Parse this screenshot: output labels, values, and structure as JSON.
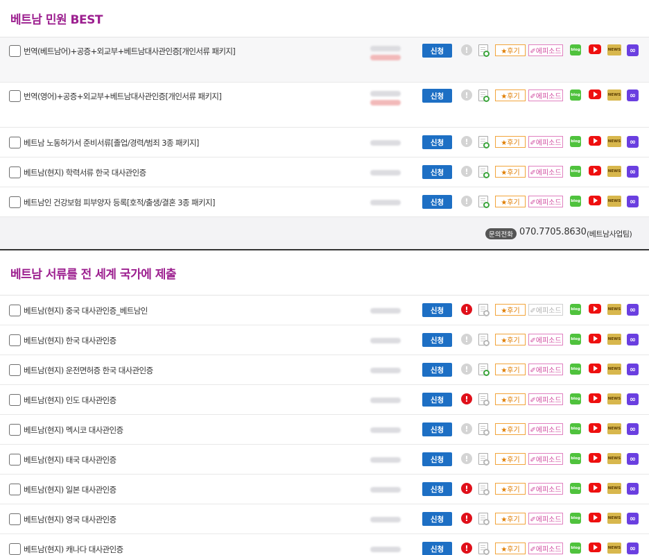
{
  "section1": {
    "title": "베트남 민원 BEST",
    "rows": [
      {
        "name": "번역(베트남어)+공증+외교부+베트남대사관인증[개인서류 패키지]",
        "height": "tall",
        "bg": true,
        "excl": "grey",
        "doc": "green",
        "episode": "on"
      },
      {
        "name": "번역(영어)+공증+외교부+베트남대사관인증[개인서류 패키지]",
        "height": "tall",
        "bg": false,
        "excl": "grey",
        "doc": "green",
        "episode": "on"
      },
      {
        "name": "베트남 노동허가서 준비서류[졸업/경력/범죄 3종 패키지]",
        "height": "norm",
        "bg": false,
        "excl": "grey",
        "doc": "green",
        "episode": "on"
      },
      {
        "name": "베트남(현지) 학력서류 한국 대사관인증",
        "height": "norm",
        "bg": false,
        "excl": "grey",
        "doc": "green",
        "episode": "on"
      },
      {
        "name": "베트남인 건강보험 피부양자 등록[호적/출생/결혼 3종 패키지]",
        "height": "norm",
        "bg": false,
        "excl": "grey",
        "doc": "green",
        "episode": "on"
      }
    ],
    "footer": {
      "pill": "문의전화",
      "phone": "070.7705.8630",
      "team": "(베트남사업팀)"
    }
  },
  "section2": {
    "title": "베트남 서류를 전 세계 국가에 제출",
    "rows": [
      {
        "name": "베트남(현지) 중국 대사관인증_베트남인",
        "height": "norm",
        "bg": false,
        "excl": "red",
        "doc": "grey",
        "episode": "off"
      },
      {
        "name": "베트남(현지) 한국 대사관인증",
        "height": "norm",
        "bg": false,
        "excl": "grey",
        "doc": "grey",
        "episode": "on"
      },
      {
        "name": "베트남(현지) 운전면허증 한국 대사관인증",
        "height": "norm",
        "bg": false,
        "excl": "grey",
        "doc": "green",
        "episode": "on"
      },
      {
        "name": "베트남(현지) 인도 대사관인증",
        "height": "norm",
        "bg": false,
        "excl": "red",
        "doc": "grey",
        "episode": "on"
      },
      {
        "name": "베트남(현지) 멕시코 대사관인증",
        "height": "norm",
        "bg": false,
        "excl": "grey",
        "doc": "grey",
        "episode": "on"
      },
      {
        "name": "베트남(현지) 태국 대사관인증",
        "height": "norm",
        "bg": false,
        "excl": "grey",
        "doc": "grey",
        "episode": "on"
      },
      {
        "name": "베트남(현지) 일본 대사관인증",
        "height": "norm",
        "bg": false,
        "excl": "red",
        "doc": "grey",
        "episode": "on"
      },
      {
        "name": "베트남(현지) 영국 대사관인증",
        "height": "norm",
        "bg": false,
        "excl": "red",
        "doc": "grey",
        "episode": "on"
      },
      {
        "name": "베트남(현지) 캐나다 대사관인증",
        "height": "norm",
        "bg": false,
        "excl": "red",
        "doc": "grey",
        "episode": "on"
      }
    ]
  },
  "labels": {
    "apply": "신청",
    "review": "★후기",
    "episode": "✐에피소드",
    "blog": "blog",
    "news": "NEWS",
    "link": "∞",
    "excl": "!"
  },
  "colors": {
    "title": "#9c1f8f",
    "apply_button": "#1d6fc4",
    "alert_red": "#e0101a",
    "review_orange": "#e07d00",
    "episode_pink": "#d04ca0",
    "blog_green": "#4fc23d",
    "youtube_red": "#ee1010",
    "link_purple": "#6a3fe0"
  },
  "icons": [
    "checkbox",
    "alert-icon",
    "document-search-icon",
    "review-badge",
    "episode-badge",
    "blog-icon",
    "youtube-icon",
    "news-icon",
    "link-icon"
  ]
}
